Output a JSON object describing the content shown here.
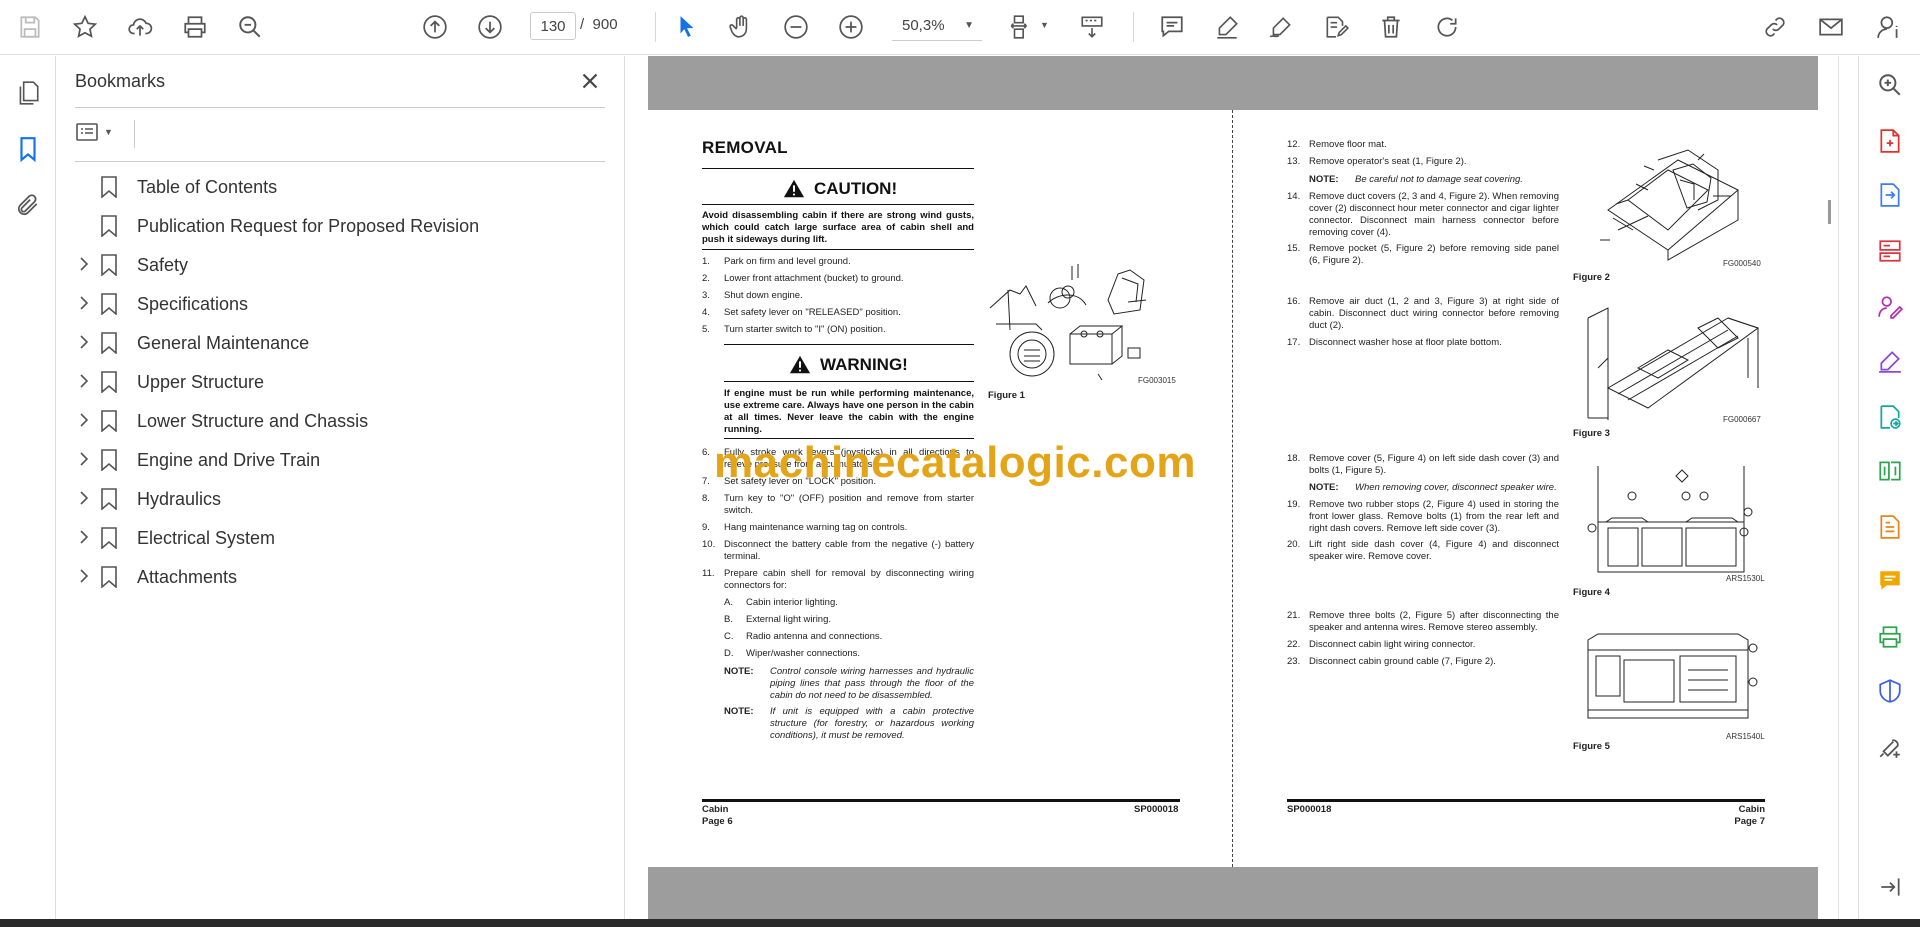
{
  "toolbar": {
    "page_current": "130",
    "page_separator": "/",
    "page_total": "900",
    "zoom": "50,3%"
  },
  "bookmarks": {
    "title": "Bookmarks",
    "items": [
      {
        "label": "Table of Contents",
        "expandable": false
      },
      {
        "label": "Publication Request for Proposed Revision",
        "expandable": false
      },
      {
        "label": "Safety",
        "expandable": true
      },
      {
        "label": "Specifications",
        "expandable": true
      },
      {
        "label": "General Maintenance",
        "expandable": true
      },
      {
        "label": "Upper Structure",
        "expandable": true
      },
      {
        "label": "Lower Structure and Chassis",
        "expandable": true
      },
      {
        "label": "Engine and Drive Train",
        "expandable": true
      },
      {
        "label": "Hydraulics",
        "expandable": true
      },
      {
        "label": "Electrical System",
        "expandable": true
      },
      {
        "label": "Attachments",
        "expandable": true
      }
    ]
  },
  "left_page": {
    "heading": "REMOVAL",
    "caution_title": "CAUTION!",
    "caution_text": "Avoid disassembling cabin if there are strong wind gusts, which could catch large surface area of cabin shell and push it sideways during lift.",
    "steps_a": [
      {
        "n": "1.",
        "t": "Park on firm and level ground."
      },
      {
        "n": "2.",
        "t": "Lower front attachment (bucket) to ground."
      },
      {
        "n": "3.",
        "t": "Shut down engine."
      },
      {
        "n": "4.",
        "t": "Set safety lever on \"RELEASED\" position."
      },
      {
        "n": "5.",
        "t": "Turn starter switch to \"I\" (ON) position."
      }
    ],
    "warning_title": "WARNING!",
    "warning_text": "If engine must be run while performing maintenance, use extreme care. Always have one person in the cabin at all times. Never leave the cabin with the engine running.",
    "steps_b": [
      {
        "n": "6.",
        "t": "Fully stroke work levers (joysticks) in all directions to relieve pressure from accumulators."
      },
      {
        "n": "7.",
        "t": "Set safety lever on \"LOCK\" position."
      },
      {
        "n": "8.",
        "t": "Turn key to \"O\" (OFF) position and remove from starter switch."
      },
      {
        "n": "9.",
        "t": "Hang maintenance warning tag on controls."
      },
      {
        "n": "10.",
        "t": "Disconnect the battery cable from the negative (-) battery terminal."
      },
      {
        "n": "11.",
        "t": "Prepare cabin shell for removal by disconnecting wiring connectors for:"
      }
    ],
    "substeps": [
      {
        "n": "A.",
        "t": "Cabin interior lighting."
      },
      {
        "n": "B.",
        "t": "External light wiring."
      },
      {
        "n": "C.",
        "t": "Radio antenna and connections."
      },
      {
        "n": "D.",
        "t": "Wiper/washer connections."
      }
    ],
    "notes": [
      {
        "k": "NOTE:",
        "v": "Control console wiring harnesses and hydraulic piping lines that pass through the floor of the cabin do not need to be disassembled."
      },
      {
        "k": "NOTE:",
        "v": "If unit is equipped with a cabin protective structure (for forestry, or hazardous working conditions), it must be removed."
      }
    ],
    "figure1_code": "FG003015",
    "figure1_caption": "Figure 1",
    "footer_left_1": "Cabin",
    "footer_left_2": "Page 6",
    "footer_right": "SP000018"
  },
  "right_page": {
    "steps_1": [
      {
        "n": "12.",
        "t": "Remove floor mat."
      },
      {
        "n": "13.",
        "t": "Remove operator's seat (1, Figure 2)."
      }
    ],
    "note_1": {
      "k": "NOTE:",
      "v": "Be careful not to damage seat covering."
    },
    "steps_2": [
      {
        "n": "14.",
        "t": "Remove duct covers (2, 3 and 4, Figure 2). When removing cover (2) disconnect hour meter connector and cigar lighter connector. Disconnect main harness connector before removing cover (4)."
      },
      {
        "n": "15.",
        "t": "Remove pocket (5, Figure 2) before removing side panel (6, Figure 2)."
      }
    ],
    "steps_3": [
      {
        "n": "16.",
        "t": "Remove air duct (1, 2 and 3, Figure 3) at right side of cabin. Disconnect duct wiring connector before removing duct (2)."
      },
      {
        "n": "17.",
        "t": "Disconnect washer hose at floor plate bottom."
      }
    ],
    "steps_4": [
      {
        "n": "18.",
        "t": "Remove cover (5, Figure 4) on left side dash cover (3) and bolts (1, Figure 5)."
      }
    ],
    "note_2": {
      "k": "NOTE:",
      "v": "When removing cover, disconnect speaker wire."
    },
    "steps_5": [
      {
        "n": "19.",
        "t": "Remove two rubber stops (2, Figure 4) used in storing the front lower glass. Remove bolts (1) from the rear left and right dash covers. Remove left side cover (3)."
      },
      {
        "n": "20.",
        "t": "Lift right side dash cover (4, Figure 4) and disconnect speaker wire. Remove cover."
      }
    ],
    "steps_6": [
      {
        "n": "21.",
        "t": "Remove three bolts (2, Figure 5) after disconnecting the speaker and antenna wires. Remove stereo assembly."
      },
      {
        "n": "22.",
        "t": "Disconnect cabin light wiring connector."
      },
      {
        "n": "23.",
        "t": "Disconnect cabin ground cable (7, Figure 2)."
      }
    ],
    "figure2_code": "FG000540",
    "figure2_caption": "Figure 2",
    "figure3_code": "FG000667",
    "figure3_caption": "Figure 3",
    "figure4_code": "ARS1530L",
    "figure4_caption": "Figure 4",
    "figure5_code": "ARS1540L",
    "figure5_caption": "Figure 5",
    "footer_left": "SP000018",
    "footer_right_1": "Cabin",
    "footer_right_2": "Page 7"
  },
  "watermark": "machinecatalogic.com"
}
